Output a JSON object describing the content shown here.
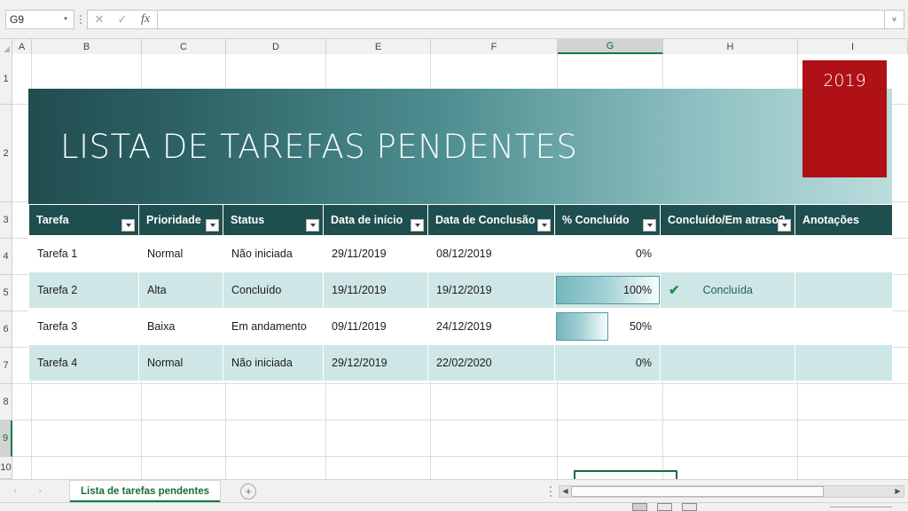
{
  "formula_bar": {
    "name_box_value": "G9",
    "name_box_caret": "▾",
    "cancel_icon": "✕",
    "confirm_icon": "✓",
    "function_icon": "fx",
    "formula_value": "",
    "expand_icon": "˅"
  },
  "columns": [
    "A",
    "B",
    "C",
    "D",
    "E",
    "F",
    "G",
    "H",
    "I"
  ],
  "selected_column": "G",
  "rows": [
    "1",
    "2",
    "3",
    "4",
    "5",
    "6",
    "7",
    "8",
    "9",
    "10"
  ],
  "selected_row": "9",
  "banner": {
    "title": "LISTA DE TAREFAS PENDENTES",
    "gradient_from": "#214d4f",
    "gradient_to": "#bcdcdd"
  },
  "year_badge": {
    "label": "2019",
    "color": "#b01116"
  },
  "table": {
    "header_color": "#1f4e4e",
    "band_color": "#cfe6e6",
    "filter_icon": "filter-dropdown",
    "headers": [
      {
        "label": "Tarefa",
        "filter": true
      },
      {
        "label": "Prioridade",
        "filter": true
      },
      {
        "label": "Status",
        "filter": true
      },
      {
        "label": "Data de início",
        "filter": true
      },
      {
        "label": "Data de Conclusão",
        "filter": true
      },
      {
        "label": "% Concluído",
        "filter": true
      },
      {
        "label": "Concluído/Em atraso?",
        "filter": true
      },
      {
        "label": "Anotações",
        "filter": false
      }
    ],
    "rows": [
      {
        "tarefa": "Tarefa 1",
        "prioridade": "Normal",
        "status": "Não iniciada",
        "data_inicio": "29/11/2019",
        "data_conclusao": "08/12/2019",
        "pct_label": "0%",
        "pct_value": 0,
        "concluido": "",
        "check": false,
        "anotacoes": ""
      },
      {
        "tarefa": "Tarefa 2",
        "prioridade": "Alta",
        "status": "Concluído",
        "data_inicio": "19/11/2019",
        "data_conclusao": "19/12/2019",
        "pct_label": "100%",
        "pct_value": 100,
        "concluido": "Concluída",
        "check": true,
        "check_icon": "✔",
        "anotacoes": ""
      },
      {
        "tarefa": "Tarefa 3",
        "prioridade": "Baixa",
        "status": "Em andamento",
        "data_inicio": "09/11/2019",
        "data_conclusao": "24/12/2019",
        "pct_label": "50%",
        "pct_value": 50,
        "concluido": "",
        "check": false,
        "anotacoes": ""
      },
      {
        "tarefa": "Tarefa 4",
        "prioridade": "Normal",
        "status": "Não iniciada",
        "data_inicio": "29/12/2019",
        "data_conclusao": "22/02/2020",
        "pct_label": "0%",
        "pct_value": 0,
        "concluido": "",
        "check": false,
        "anotacoes": ""
      }
    ]
  },
  "selected_cell": {
    "reference": "G9",
    "value": "",
    "border_color": "#1b6b3a"
  },
  "tabbar": {
    "prev_icon": "‹",
    "next_icon": "›",
    "sheet_name": "Lista de tarefas pendentes",
    "add_sheet_icon": "+",
    "scroll_left_icon": "◀",
    "scroll_right_icon": "▶"
  }
}
